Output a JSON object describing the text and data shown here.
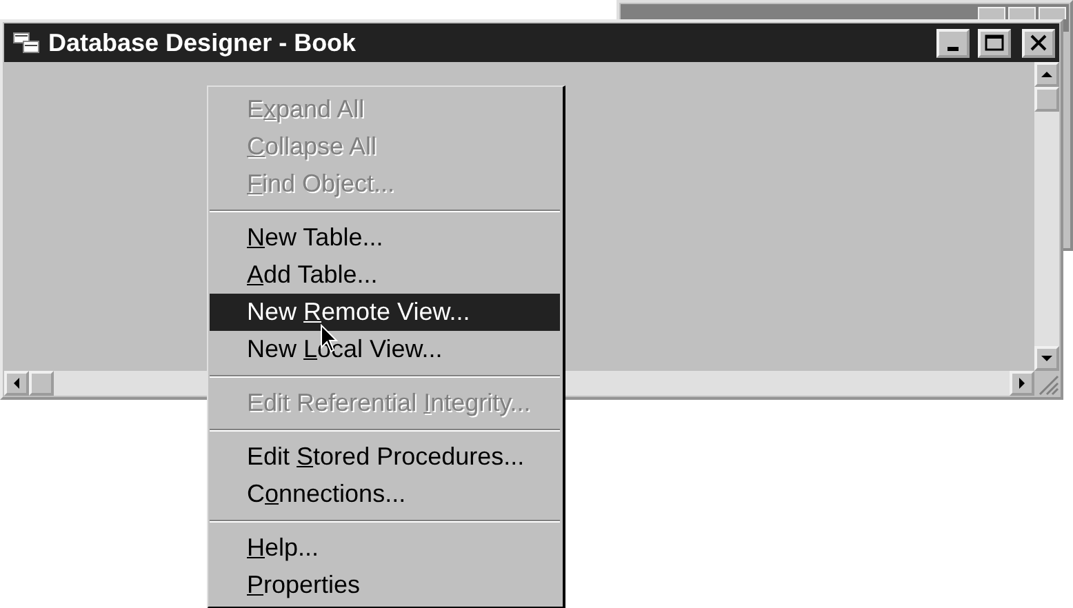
{
  "window": {
    "title": "Database Designer - Book",
    "active": true
  },
  "background_window": {
    "active": false
  },
  "context_menu": [
    {
      "kind": "item",
      "label": [
        {
          "text": "E",
          "underlined": false
        },
        {
          "text": "x",
          "underlined": true
        },
        {
          "text": "pand All",
          "underlined": false
        }
      ],
      "disabled": true,
      "selected": false
    },
    {
      "kind": "item",
      "label": [
        {
          "text": "C",
          "underlined": true
        },
        {
          "text": "ollapse All",
          "underlined": false
        }
      ],
      "disabled": true,
      "selected": false
    },
    {
      "kind": "item",
      "label": [
        {
          "text": "F",
          "underlined": true
        },
        {
          "text": "ind Object...",
          "underlined": false
        }
      ],
      "disabled": true,
      "selected": false
    },
    {
      "kind": "separator"
    },
    {
      "kind": "item",
      "label": [
        {
          "text": "N",
          "underlined": true
        },
        {
          "text": "ew Table...",
          "underlined": false
        }
      ],
      "disabled": false,
      "selected": false
    },
    {
      "kind": "item",
      "label": [
        {
          "text": "A",
          "underlined": true
        },
        {
          "text": "dd Table...",
          "underlined": false
        }
      ],
      "disabled": false,
      "selected": false
    },
    {
      "kind": "item",
      "label": [
        {
          "text": "New ",
          "underlined": false
        },
        {
          "text": "R",
          "underlined": true
        },
        {
          "text": "emote View...",
          "underlined": false
        }
      ],
      "disabled": false,
      "selected": true
    },
    {
      "kind": "item",
      "label": [
        {
          "text": "New ",
          "underlined": false
        },
        {
          "text": "L",
          "underlined": true
        },
        {
          "text": "ocal View...",
          "underlined": false
        }
      ],
      "disabled": false,
      "selected": false
    },
    {
      "kind": "separator"
    },
    {
      "kind": "item",
      "label": [
        {
          "text": "Edit Referential ",
          "underlined": false
        },
        {
          "text": "I",
          "underlined": true
        },
        {
          "text": "ntegrity...",
          "underlined": false
        }
      ],
      "disabled": true,
      "selected": false
    },
    {
      "kind": "separator"
    },
    {
      "kind": "item",
      "label": [
        {
          "text": "Edit ",
          "underlined": false
        },
        {
          "text": "S",
          "underlined": true
        },
        {
          "text": "tored Procedures...",
          "underlined": false
        }
      ],
      "disabled": false,
      "selected": false
    },
    {
      "kind": "item",
      "label": [
        {
          "text": "C",
          "underlined": false
        },
        {
          "text": "o",
          "underlined": true
        },
        {
          "text": "nnections...",
          "underlined": false
        }
      ],
      "disabled": false,
      "selected": false
    },
    {
      "kind": "separator"
    },
    {
      "kind": "item",
      "label": [
        {
          "text": "H",
          "underlined": true
        },
        {
          "text": "elp...",
          "underlined": false
        }
      ],
      "disabled": false,
      "selected": false
    },
    {
      "kind": "item",
      "label": [
        {
          "text": "P",
          "underlined": true
        },
        {
          "text": "roperties",
          "underlined": false
        }
      ],
      "disabled": false,
      "selected": false
    }
  ]
}
